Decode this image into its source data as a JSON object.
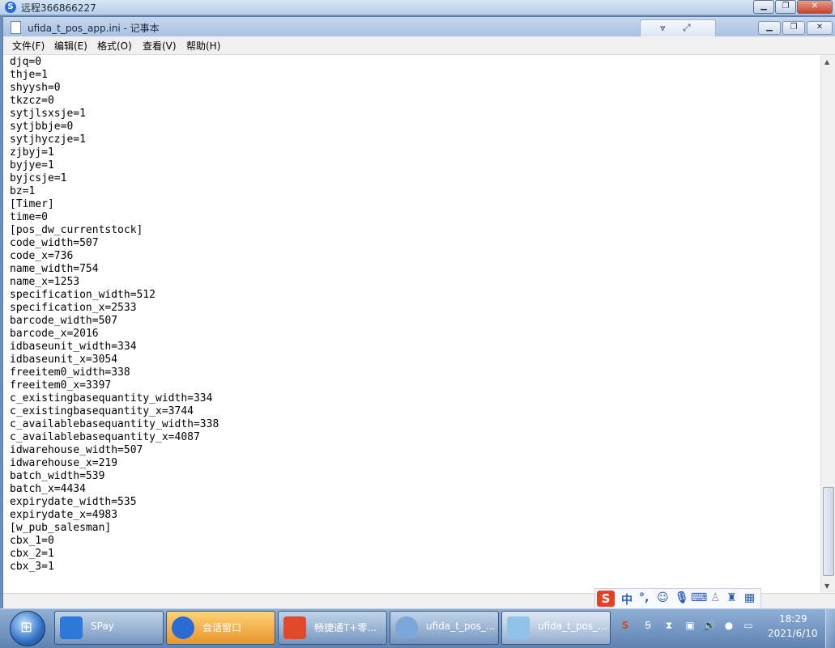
{
  "remote": {
    "title": "远程366866227",
    "controls": {
      "minimize": "▁",
      "restore": "❐",
      "close": "✕"
    }
  },
  "notepad": {
    "title": "ufida_t_pos_app.ini - 记事本",
    "controls": {
      "minimize": "▁",
      "restore": "❐",
      "close": "✕"
    },
    "menu": [
      {
        "label": "文件(F)"
      },
      {
        "label": "编辑(E)"
      },
      {
        "label": "格式(O)"
      },
      {
        "label": "查看(V)"
      },
      {
        "label": "帮助(H)"
      }
    ],
    "content": "djq=0\nthje=1\nshyysh=0\ntkzcz=0\nsytjlsxsje=1\nsytjbbje=0\nsytjhyczje=1\nzjbyj=1\nbyjye=1\nbyjcsje=1\nbz=1\n[Timer]\ntime=0\n[pos_dw_currentstock]\ncode_width=507\ncode_x=736\nname_width=754\nname_x=1253\nspecification_width=512\nspecification_x=2533\nbarcode_width=507\nbarcode_x=2016\nidbaseunit_width=334\nidbaseunit_x=3054\nfreeitem0_width=338\nfreeitem0_x=3397\nc_existingbasequantity_width=334\nc_existingbasequantity_x=3744\nc_availablebasequantity_width=338\nc_availablebasequantity_x=4087\nidwarehouse_width=507\nidwarehouse_x=219\nbatch_width=539\nbatch_x=4434\nexpirydate_width=535\nexpirydate_x=4983\n[w_pub_salesman]\ncbx_1=0\ncbx_2=1\ncbx_3=1"
  },
  "ime": {
    "logo": "S",
    "lang": "中",
    "punct": "°,",
    "icons": [
      "smile-icon",
      "microphone-icon",
      "keyboard-icon",
      "person-icon",
      "shirt-icon",
      "grid-icon"
    ]
  },
  "taskbar": {
    "items": [
      {
        "label": "SPay",
        "icon": "phone-icon",
        "color": "#2f79d6"
      },
      {
        "label": "会话窗口",
        "icon": "chat-icon",
        "color": "#2b6bd6"
      },
      {
        "label": "畅捷通T+零...",
        "icon": "app-grid-icon",
        "color": "#e0492b"
      },
      {
        "label": "ufida_t_pos_...",
        "icon": "magnifier-icon",
        "color": "#7aa6d8"
      },
      {
        "label": "ufida_t_pos_...",
        "icon": "notepad-icon",
        "color": "#8fc3e8"
      }
    ],
    "tray": [
      "sogou-icon",
      "remote-icon",
      "hourglass-icon",
      "network-app-icon",
      "volume-icon",
      "chat-bubble-icon",
      "monitor-icon"
    ],
    "clock": {
      "time": "18:29",
      "date": "2021/6/10"
    }
  }
}
